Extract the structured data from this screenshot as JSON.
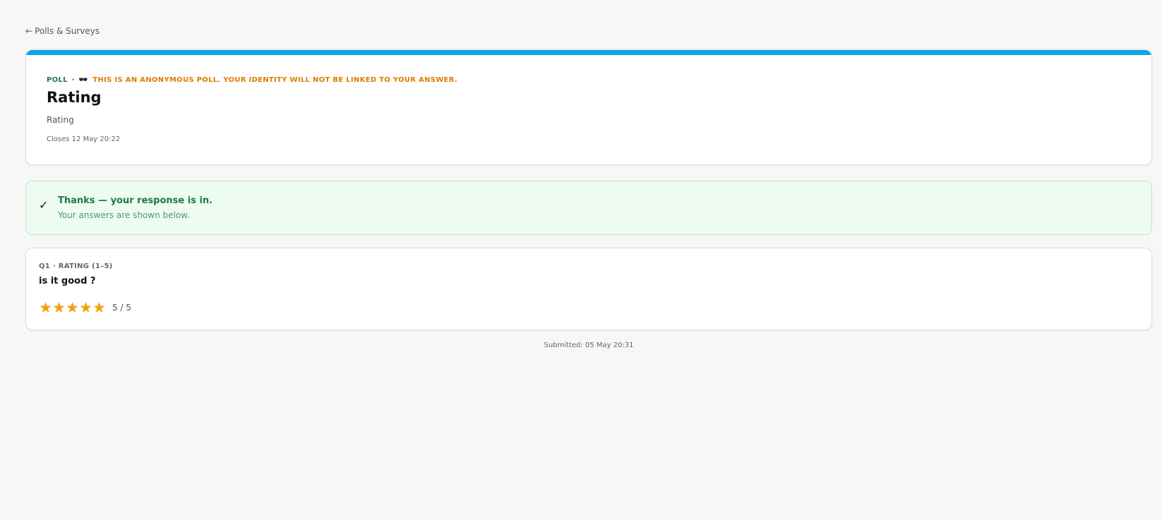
{
  "nav": {
    "back_arrow": "←",
    "back_label": "Polls & Surveys"
  },
  "header": {
    "accent_color": "#0ea5e9",
    "type": "POLL",
    "separator": "·",
    "anon_icon": "dark-glasses-icon",
    "anon_glyph": "🕶",
    "anon_note": "THIS IS AN ANONYMOUS POLL. YOUR IDENTITY WILL NOT BE LINKED TO YOUR ANSWER.",
    "title": "Rating",
    "subtitle": "Rating",
    "closes": "Closes 12 May 20:22"
  },
  "banner": {
    "icon": "checkmark-icon",
    "glyph": "✓",
    "title": "Thanks — your response is in.",
    "subtitle": "Your answers are shown below."
  },
  "question": {
    "label": "Q1 · RATING (1–5)",
    "text": "is it good ?",
    "rating": 5,
    "max_rating": 5,
    "star_color": "#f59e0b",
    "star_glyph": "★",
    "rating_text": "5 / 5"
  },
  "footer": {
    "submitted": "Submitted: 05 May 20:31"
  }
}
